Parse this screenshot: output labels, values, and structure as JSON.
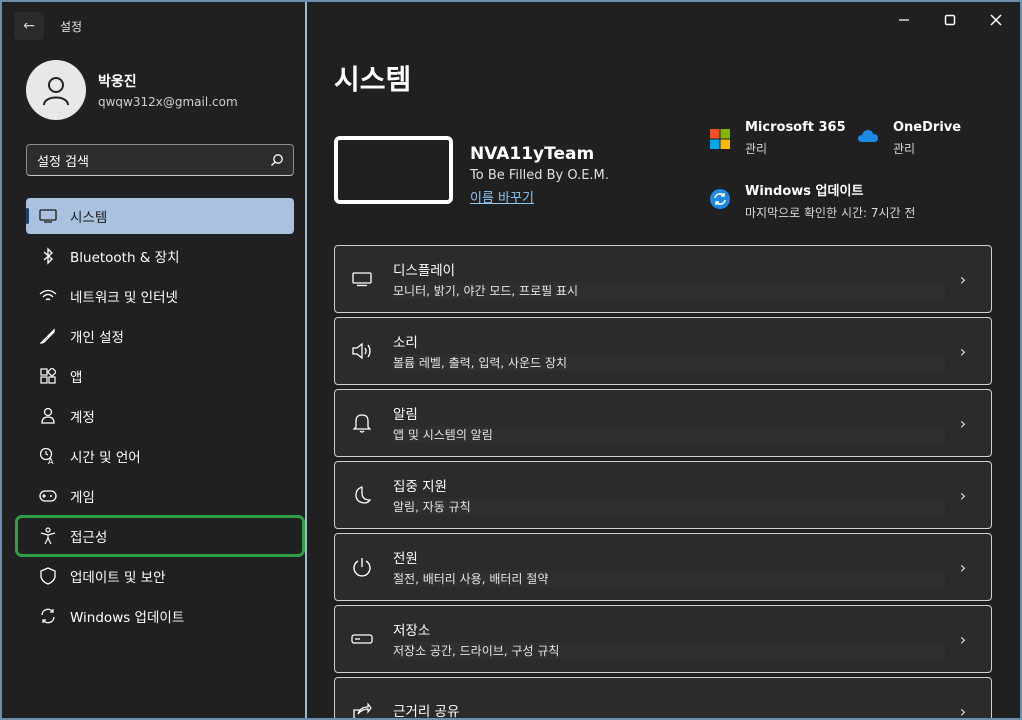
{
  "app": {
    "title": "설정",
    "back_icon": "arrow-left-icon"
  },
  "user": {
    "name": "박웅진",
    "email": "qwqw312x@gmail.com"
  },
  "search": {
    "placeholder": "설정 검색",
    "value": "설정 검색"
  },
  "nav": [
    {
      "label": "시스템",
      "icon": "monitor-icon",
      "active": true
    },
    {
      "label": "Bluetooth & 장치",
      "icon": "bluetooth-icon"
    },
    {
      "label": "네트워크 및 인터넷",
      "icon": "wifi-icon"
    },
    {
      "label": "개인 설정",
      "icon": "brush-icon"
    },
    {
      "label": "앱",
      "icon": "apps-icon"
    },
    {
      "label": "계정",
      "icon": "person-icon"
    },
    {
      "label": "시간 및 언어",
      "icon": "time-language-icon"
    },
    {
      "label": "게임",
      "icon": "gamepad-icon"
    },
    {
      "label": "접근성",
      "icon": "accessibility-icon",
      "focused": true
    },
    {
      "label": "업데이트 및 보안",
      "icon": "shield-icon"
    },
    {
      "label": "Windows 업데이트",
      "icon": "update-icon"
    }
  ],
  "main": {
    "title": "시스템",
    "device": {
      "name": "NVA11yTeam",
      "model": "To Be Filled By O.E.M.",
      "rename": "이름 바꾸기"
    },
    "quick": [
      {
        "title": "Microsoft 365",
        "sub": "관리",
        "icon": "microsoft-logo-icon"
      },
      {
        "title": "OneDrive",
        "sub": "관리",
        "icon": "onedrive-cloud-icon"
      },
      {
        "title": "Windows 업데이트",
        "sub": "마지막으로 확인한 시간: 7시간 전",
        "icon": "windows-update-icon"
      }
    ],
    "cards": [
      {
        "title": "디스플레이",
        "sub": "모니터, 밝기, 야간 모드, 프로필 표시",
        "icon": "display-icon"
      },
      {
        "title": "소리",
        "sub": "볼륨 레벨, 출력, 입력, 사운드 장치",
        "icon": "speaker-icon"
      },
      {
        "title": "알림",
        "sub": "앱 및 시스템의 알림",
        "icon": "bell-icon"
      },
      {
        "title": "집중 지원",
        "sub": "알림, 자동 규칙",
        "icon": "moon-icon"
      },
      {
        "title": "전원",
        "sub": "절전, 배터리 사용, 배터리 절약",
        "icon": "power-icon"
      },
      {
        "title": "저장소",
        "sub": "저장소 공간, 드라이브, 구성 규칙",
        "icon": "storage-icon"
      },
      {
        "title": "근거리 공유",
        "sub": "",
        "icon": "share-icon"
      }
    ]
  },
  "colors": {
    "accent": "#a8c2df",
    "focus": "#2ea043",
    "link": "#8fc3f0"
  }
}
